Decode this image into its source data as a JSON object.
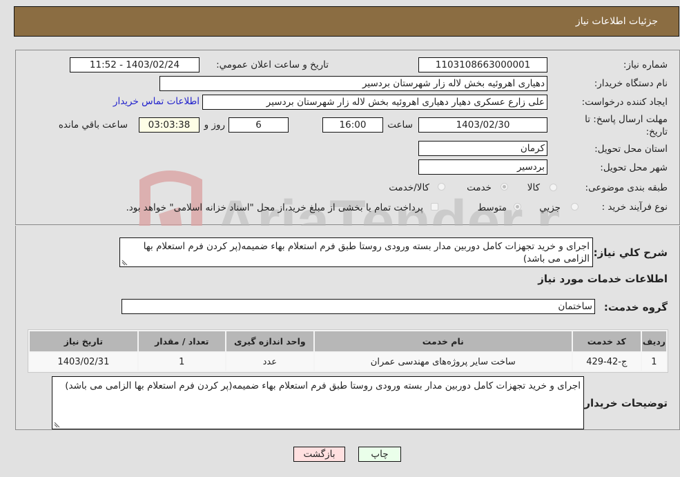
{
  "header": {
    "title": "جزئیات اطلاعات نیاز"
  },
  "form": {
    "need_number": {
      "label": "شماره نیاز:",
      "value": "1103108663000001"
    },
    "announce_datetime": {
      "label": "تاریخ و ساعت اعلان عمومي:",
      "value": "1403/02/24 - 11:52"
    },
    "buyer_org": {
      "label": "نام دستگاه خريدار:",
      "value": "دهیاری اهروئیه بخش لاله زار شهرستان بردسیر"
    },
    "requester": {
      "label": "ايجاد كننده درخواست:",
      "value": "علی زارع عسکری دهیار دهیاری اهروئیه بخش لاله زار شهرستان بردسیر"
    },
    "buyer_contact_link": "اطلاعات تماس خریدار",
    "deadline": {
      "label": "مهلت ارسال پاسخ: تا تاريخ:",
      "date": "1403/02/30",
      "time_label": "ساعت",
      "time": "16:00",
      "days": "6",
      "days_label": "روز و",
      "remaining": "03:03:38",
      "remaining_label": "ساعت باقي مانده"
    },
    "province": {
      "label": "استان محل تحويل:",
      "value": "کرمان"
    },
    "city": {
      "label": "شهر محل تحويل:",
      "value": "بردسیر"
    },
    "category": {
      "label": "طبقه بندی موضوعی:",
      "options": [
        "کالا",
        "خدمت",
        "کالا/خدمت"
      ],
      "selected": "خدمت"
    },
    "purchase_type": {
      "label": "نوع فرآيند خريد :",
      "options": [
        "جزيي",
        "متوسط"
      ],
      "selected": "متوسط",
      "treasury_note": "پرداخت تمام يا بخشی از مبلغ خرید،از محل \"اسناد خزانه اسلامی\" خواهد بود."
    },
    "general_description": {
      "label": "شرح كلي نياز:",
      "value": "اجرای و خرید تجهزات کامل دوربین مدار بسته ورودی روستا طبق فرم استعلام بهاء ضمیمه(پر کردن فرم استعلام بها الزامی می باشد)"
    }
  },
  "services": {
    "section_title": "اطلاعات خدمات مورد نياز",
    "group_label": "گروه خدمت:",
    "group_value": "ساختمان",
    "columns": [
      "رديف",
      "كد خدمت",
      "نام خدمت",
      "واحد اندازه گيری",
      "تعداد / مقدار",
      "تاريخ نياز"
    ],
    "rows": [
      [
        "1",
        "ج-42-429",
        "ساخت سایر پروژه‌های مهندسی عمران",
        "عدد",
        "1",
        "1403/02/31"
      ]
    ]
  },
  "buyer_notes": {
    "label": "توضيحات خريدار:",
    "value": "اجرای و خرید تجهزات کامل دوربین مدار بسته ورودی روستا طبق فرم استعلام بهاء ضمیمه(پر کردن فرم استعلام بها الزامی می باشد)"
  },
  "buttons": {
    "print": "چاپ",
    "back": "بازگشت"
  },
  "watermark": {
    "text": "AriaTender.neT"
  },
  "colors": {
    "header_bg": "#8b6d42",
    "print_bg": "#eaffea",
    "back_bg": "#ffe0e0",
    "link": "#2222cc"
  }
}
